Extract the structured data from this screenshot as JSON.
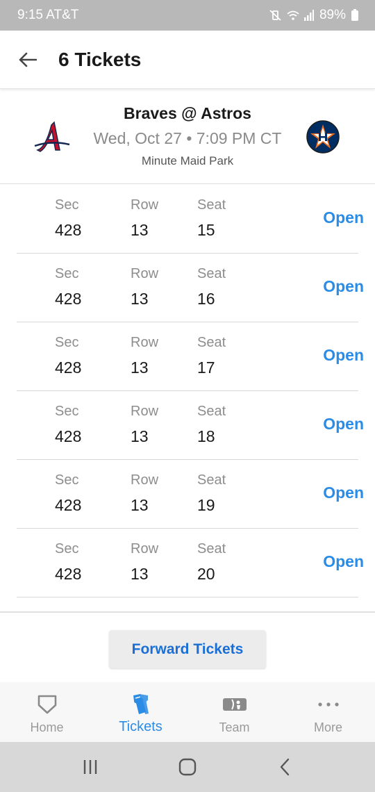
{
  "status_bar": {
    "time_carrier": "9:15 AT&T",
    "battery": "89%"
  },
  "header": {
    "title": "6 Tickets"
  },
  "game": {
    "matchup": "Braves @ Astros",
    "datetime": "Wed, Oct 27 • 7:09 PM CT",
    "venue": "Minute Maid Park",
    "away_logo_letter": "A",
    "home_logo_letter": "H"
  },
  "labels": {
    "sec": "Sec",
    "row": "Row",
    "seat": "Seat",
    "open": "Open"
  },
  "tickets": [
    {
      "sec": "428",
      "row": "13",
      "seat": "15"
    },
    {
      "sec": "428",
      "row": "13",
      "seat": "16"
    },
    {
      "sec": "428",
      "row": "13",
      "seat": "17"
    },
    {
      "sec": "428",
      "row": "13",
      "seat": "18"
    },
    {
      "sec": "428",
      "row": "13",
      "seat": "19"
    },
    {
      "sec": "428",
      "row": "13",
      "seat": "20"
    }
  ],
  "forward_button": "Forward Tickets",
  "bottom_nav": [
    {
      "label": "Home",
      "icon": "home-plate-icon",
      "active": false
    },
    {
      "label": "Tickets",
      "icon": "tickets-icon",
      "active": true
    },
    {
      "label": "Team",
      "icon": "team-logo-icon",
      "active": false
    },
    {
      "label": "More",
      "icon": "more-dots-icon",
      "active": false
    }
  ],
  "colors": {
    "accent": "#2b8ce6",
    "forward_text": "#1a6fd6",
    "braves_red": "#c8102e",
    "braves_navy": "#13274f",
    "astros_navy": "#002d62",
    "astros_orange": "#eb6e1f"
  }
}
